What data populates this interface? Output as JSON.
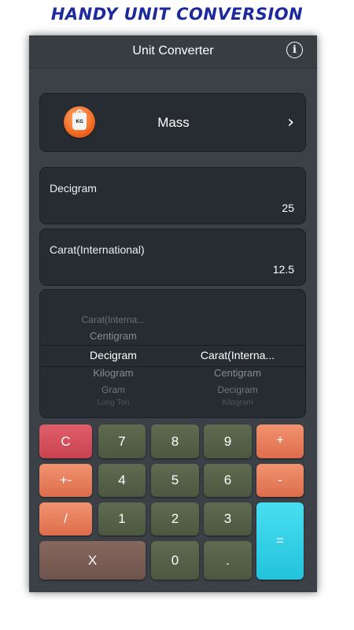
{
  "banner": {
    "title": "HANDY UNIT CONVERSION"
  },
  "header": {
    "title": "Unit Converter",
    "info_icon": "info-circle-icon"
  },
  "category": {
    "icon": "weight-kg-icon",
    "icon_text": "KG",
    "label": "Mass",
    "chevron": "›"
  },
  "from_field": {
    "unit": "Decigram",
    "value": "25"
  },
  "to_field": {
    "unit": "Carat(International)",
    "value": "12.5"
  },
  "picker": {
    "left": {
      "items": [
        "Carat(Interna...",
        "Centigram",
        "Decigram",
        "Kilogram",
        "Gram",
        "Long Ton"
      ],
      "selected": "Decigram"
    },
    "right": {
      "items": [
        "Carat(Interna...",
        "Centigram",
        "Decigram",
        "Kilogram"
      ],
      "selected": "Carat(Interna..."
    }
  },
  "keypad": {
    "clear": "C",
    "seven": "7",
    "eight": "8",
    "nine": "9",
    "plus": "+",
    "plusminus": "+-",
    "four": "4",
    "five": "5",
    "six": "6",
    "minus": "-",
    "divide": "/",
    "one": "1",
    "two": "2",
    "three": "3",
    "equals": "=",
    "multiply": "X",
    "zero": "0",
    "dot": "."
  },
  "colors": {
    "background": "#3b4147",
    "panel": "#262c31",
    "clear_key": "#d4505c",
    "number_key": "#566149",
    "operator_key": "#e87b5a",
    "equals_key": "#33d0e6"
  }
}
